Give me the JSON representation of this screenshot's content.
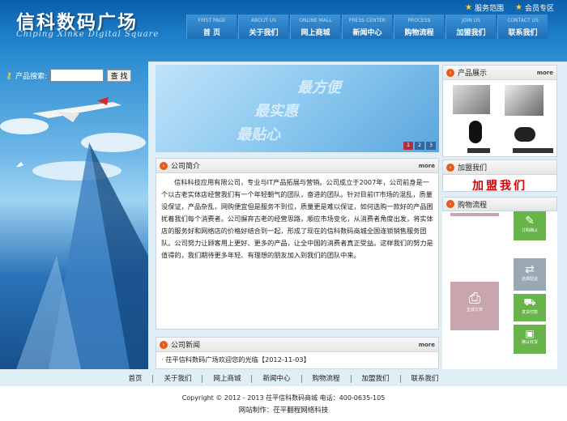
{
  "header": {
    "logo": "信科数码广场",
    "logo_en": "Chiping Xinke Digital Square",
    "toplinks": [
      {
        "label": "服务范围"
      },
      {
        "label": "会员专区"
      }
    ]
  },
  "nav": [
    {
      "en": "FIRST PAGE",
      "cn": "首 页"
    },
    {
      "en": "ABOUT US",
      "cn": "关于我们"
    },
    {
      "en": "ONLINE MALL",
      "cn": "网上商城"
    },
    {
      "en": "PRESS CENTER",
      "cn": "新闻中心"
    },
    {
      "en": "PROCESS",
      "cn": "购物流程"
    },
    {
      "en": "JOIN US",
      "cn": "加盟我们"
    },
    {
      "en": "CONTACT US",
      "cn": "联系我们"
    }
  ],
  "search": {
    "label": "产品搜索:",
    "button": "查 找",
    "value": ""
  },
  "banner": {
    "slogans": [
      "最方便",
      "最实惠",
      "最贴心"
    ],
    "pages": [
      "1",
      "2",
      "3"
    ]
  },
  "intro": {
    "title": "公司简介",
    "more": "more",
    "text": "信科科技应用有限公司，专业与IT产品拓展与营销。公司成立于2007年，公司前身是一个以古老实体店经营我们有一个年轻朝气的团队，奋进的团队。针对目前IT市场的混乱，质量没保证，产品杂乱，网购便宜但是服务不到位，质量更是难以保证，如何选购一款好的产品困扰着我们每个消费者。公司摒弃古老的经营思路，顺应市场变化，从消费者角度出发，将实体店的服务好和网络店的价格好结合到一起，形成了现在的信科数码商城全国连锁销售服务团队。公司努力让顾客用上更好、更多的产品，让全中国的消费者真正受益。这样我们的努力是值得的，我们期待更多年轻、有理想的朋友加入到我们的团队中来。"
  },
  "news": {
    "title": "公司新闻",
    "more": "more",
    "items": [
      "· 茌平信科数码广场欢迎您的光临【2012-11-03】"
    ]
  },
  "products": {
    "title": "产品展示",
    "more": "more"
  },
  "join": {
    "title": "加盟我们",
    "text": "加盟我们"
  },
  "flow": {
    "title": "购物流程",
    "nodes": [
      "订购确认",
      "选择配送",
      "发货付款",
      "生成订单",
      "确认收货"
    ]
  },
  "footnav": [
    "首页",
    "关于我们",
    "网上商城",
    "新闻中心",
    "购物流程",
    "加盟我们",
    "联系我们"
  ],
  "footer": {
    "copy": "Copyright © 2012 - 2013 茌平信科数码商城 电话：400-0635-105",
    "made": "网站制作：茌平翻程网络科技"
  },
  "colors": {
    "header": "#1c7dc7",
    "accent": "#e35c1a",
    "join": "#d60000"
  }
}
